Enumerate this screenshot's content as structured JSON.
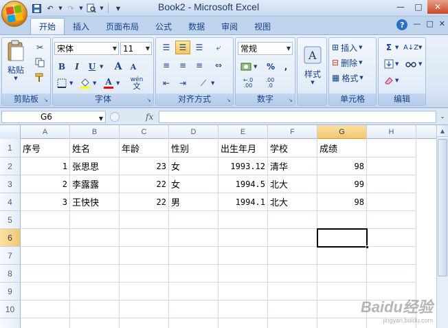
{
  "window": {
    "title": "Book2 - Microsoft Excel",
    "controls": [
      "—",
      "□",
      "✕"
    ]
  },
  "ribbon_tabs": [
    {
      "label": "开始",
      "active": true
    },
    {
      "label": "插入"
    },
    {
      "label": "页面布局"
    },
    {
      "label": "公式"
    },
    {
      "label": "数据"
    },
    {
      "label": "审阅"
    },
    {
      "label": "视图"
    }
  ],
  "groups": {
    "clipboard": {
      "label": "剪贴板",
      "paste_label": "粘贴"
    },
    "font": {
      "label": "字体",
      "font_name": "宋体",
      "font_size": "11",
      "bold": "B",
      "italic": "I",
      "underline": "U",
      "grow": "A",
      "shrink": "A",
      "font_color": "A",
      "phonetic": "wén"
    },
    "alignment": {
      "label": "对齐方式"
    },
    "number": {
      "label": "数字",
      "format": "常规",
      "percent": "%",
      "comma": ",",
      "inc_decimal": ".00",
      "dec_decimal": ".0"
    },
    "styles": {
      "label": "",
      "styles_label": "样式"
    },
    "cells": {
      "label": "单元格",
      "insert": "插入",
      "delete": "删除",
      "format": "格式"
    },
    "editing": {
      "label": "编辑",
      "sigma": "Σ"
    }
  },
  "formula_bar": {
    "name_box": "G6",
    "fx": "fx",
    "value": ""
  },
  "sheet": {
    "columns": [
      "A",
      "B",
      "C",
      "D",
      "E",
      "F",
      "G",
      "H"
    ],
    "rows": [
      "1",
      "2",
      "3",
      "4",
      "5",
      "6",
      "7",
      "8",
      "9",
      "10"
    ],
    "selected_col": "G",
    "selected_row": "6",
    "cells": {
      "header": [
        "序号",
        "姓名",
        "年龄",
        "性别",
        "出生年月",
        "学校",
        "成绩"
      ],
      "r2": [
        "1",
        "张思思",
        "23",
        "女",
        "1993.12",
        "清华",
        "98"
      ],
      "r3": [
        "2",
        "李露露",
        "22",
        "女",
        "1994.5",
        "北大",
        "99"
      ],
      "r4": [
        "3",
        "王快快",
        "22",
        "男",
        "1994.1",
        "北大",
        "98"
      ]
    }
  },
  "watermark": {
    "main": "Baidu经验",
    "sub": "jingyan.baidu.com"
  }
}
